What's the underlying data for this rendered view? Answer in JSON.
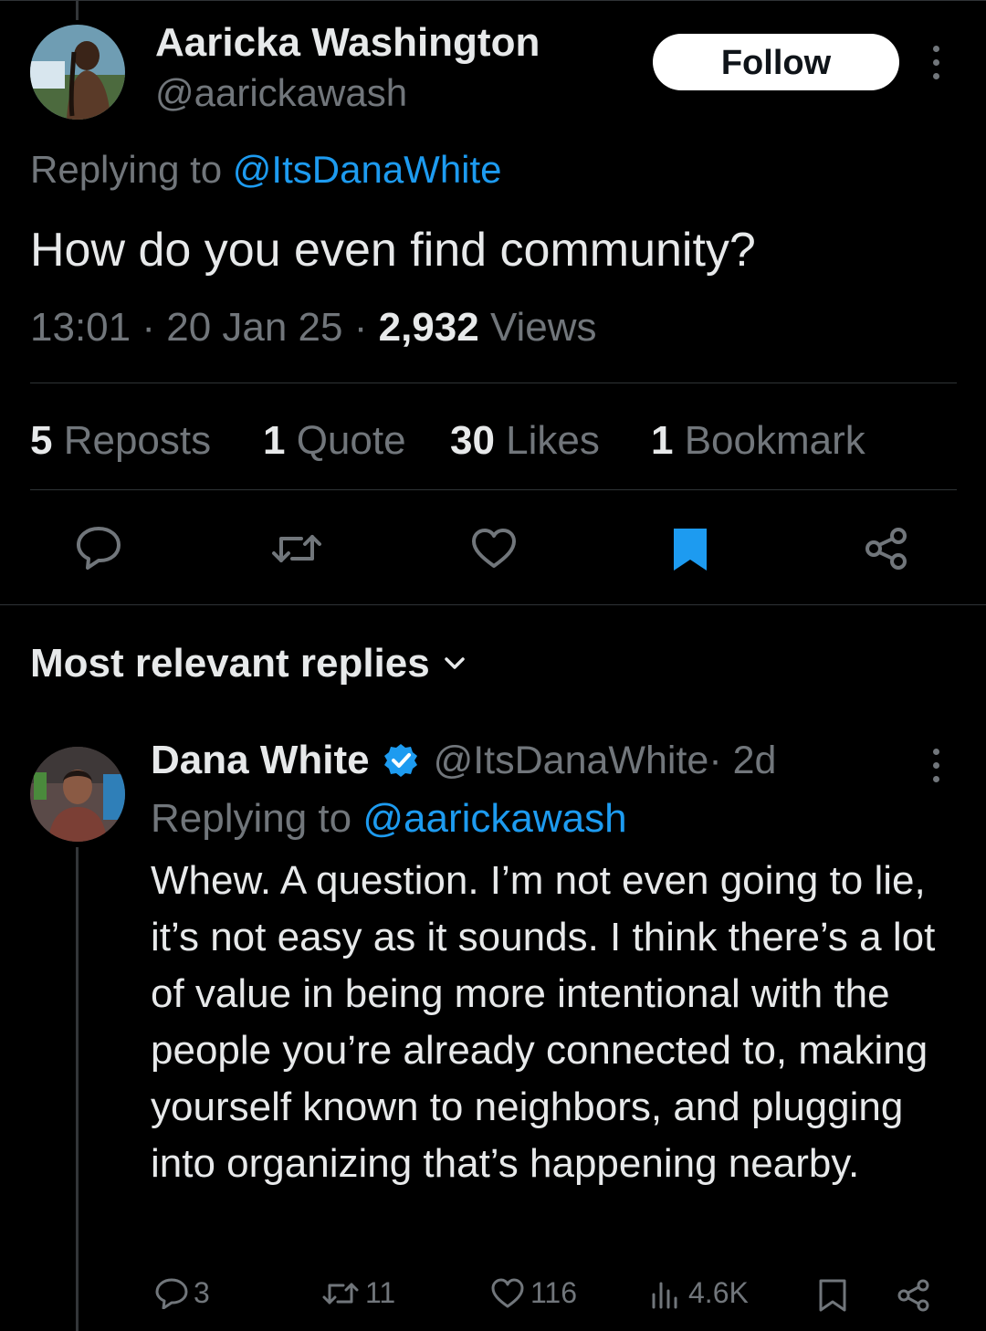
{
  "tweet": {
    "author_name": "Aaricka Washington",
    "author_handle": "@aarickawash",
    "follow_label": "Follow",
    "replying_prefix": "Replying to ",
    "replying_handle": "@ItsDanaWhite",
    "text": "How do you even find community?",
    "time": "13:01",
    "date": "20 Jan 25",
    "separator": " · ",
    "views_count": "2,932",
    "views_label": " Views",
    "stats": {
      "reposts_count": "5",
      "reposts_label": " Reposts",
      "quotes_count": "1",
      "quotes_label": " Quote",
      "likes_count": "30",
      "likes_label": " Likes",
      "bookmarks_count": "1",
      "bookmarks_label": " Bookmark"
    },
    "actions": [
      "reply-icon",
      "repost-icon",
      "like-icon",
      "bookmark-filled-icon",
      "share-icon"
    ],
    "bookmark_color": "#1d9bf0"
  },
  "replies_header": {
    "label": "Most relevant replies"
  },
  "reply": {
    "author_name": "Dana White",
    "verified": true,
    "author_handle": "@ItsDanaWhite",
    "age": " · 2d",
    "replying_prefix": "Replying to ",
    "replying_handle": "@aarickawash",
    "text": "Whew. A question. I’m not even going to lie, it’s not easy as it sounds. I think there’s a lot of value in being more intentional with the people you’re already connected to, making yourself known to neighbors, and plugging into organizing that’s happening nearby.",
    "metrics": {
      "replies": "3",
      "reposts": "11",
      "likes": "116",
      "views": "4.6K"
    }
  },
  "colors": {
    "background": "#000000",
    "text": "#e7e9ea",
    "secondary": "#71767b",
    "accent": "#1d9bf0",
    "divider": "#2f3336"
  }
}
